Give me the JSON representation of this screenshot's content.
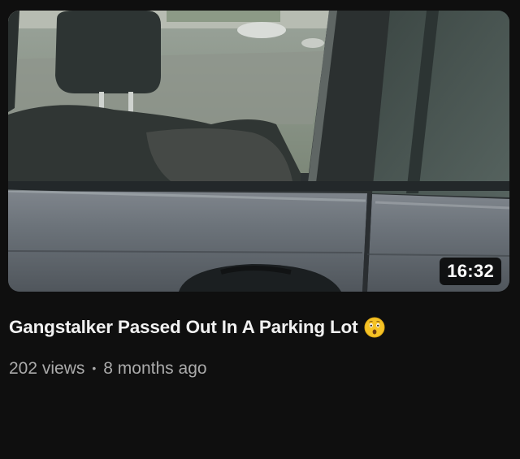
{
  "video": {
    "duration": "16:32",
    "title": "Gangstalker Passed Out In A Parking Lot",
    "title_emoji": "astonished-face-icon",
    "views": "202 views",
    "separator": "•",
    "age": "8 months ago"
  },
  "colors": {
    "background": "#0f0f0f",
    "title_text": "#f1f1f1",
    "meta_text": "#aaaaaa",
    "duration_badge": "#000000"
  }
}
